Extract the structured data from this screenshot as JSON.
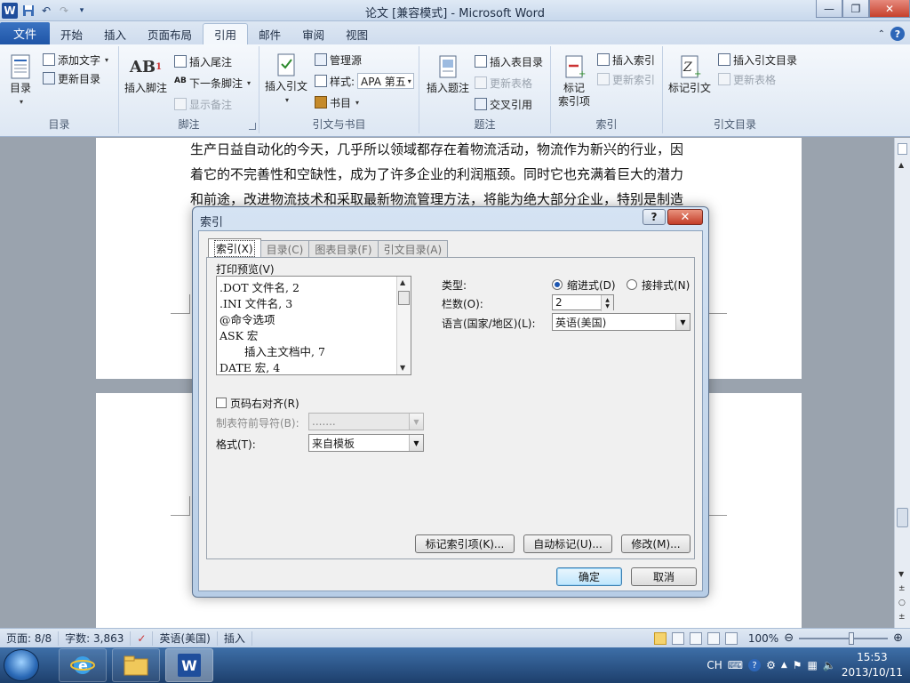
{
  "window": {
    "title": "论文 [兼容模式] - Microsoft Word"
  },
  "ribbon_tabs": {
    "file": "文件",
    "items": [
      "开始",
      "插入",
      "页面布局",
      "引用",
      "邮件",
      "审阅",
      "视图"
    ],
    "active": "引用"
  },
  "ribbon": {
    "toc": {
      "big": "目录",
      "add_text": "添加文字",
      "update_toc": "更新目录",
      "label": "目录"
    },
    "footnote": {
      "insert_footnote": "插入脚注",
      "insert_endnote": "插入尾注",
      "next_footnote": "下一条脚注",
      "show_notes": "显示备注",
      "label": "脚注"
    },
    "citation": {
      "insert_citation": "插入引文",
      "manage_sources": "管理源",
      "style_label": "样式:",
      "style_value": "APA 第五",
      "bibliography": "书目",
      "label": "引文与书目"
    },
    "caption": {
      "insert_caption": "插入题注",
      "insert_table_of_figures": "插入表目录",
      "update_table": "更新表格",
      "cross_reference": "交叉引用",
      "label": "题注"
    },
    "index": {
      "mark_entry": "标记\n索引项",
      "mark_entry_l1": "标记",
      "mark_entry_l2": "索引项",
      "insert_index": "插入索引",
      "update_index": "更新索引",
      "label": "索引"
    },
    "toa": {
      "mark_citation": "标记引文",
      "insert_toa": "插入引文目录",
      "update_table": "更新表格",
      "label": "引文目录"
    }
  },
  "document": {
    "lines": [
      "生产日益自动化的今天，几乎所以领域都存在着物流活动，物流作为新兴的行业，因",
      "着它的不完善性和空缺性，成为了许多企业的利润瓶颈。同时它也充满着巨大的潜力",
      "和前途，改进物流技术和采取最新物流管理方法，将能为绝大部分企业，特别是制造"
    ]
  },
  "dialog": {
    "title": "索引",
    "help": "?",
    "close": "✕",
    "tabs": [
      "索引(X)",
      "目录(C)",
      "图表目录(F)",
      "引文目录(A)"
    ],
    "preview_label": "打印预览(V)",
    "preview_lines": [
      ".DOT 文件名, 2",
      ".INI 文件名, 3",
      "@命令选项",
      "ASK 宏",
      "插入主文档中, 7",
      "DATE 宏, 4"
    ],
    "type_label": "类型:",
    "type_indent": "缩进式(D)",
    "type_runin": "接排式(N)",
    "columns_label": "栏数(O):",
    "columns_value": "2",
    "language_label": "语言(国家/地区)(L):",
    "language_value": "英语(美国)",
    "right_align_label": "页码右对齐(R)",
    "tab_leader_label": "制表符前导符(B):",
    "tab_leader_value": ".......",
    "format_label": "格式(T):",
    "format_value": "来自模板",
    "mark_entry_btn": "标记索引项(K)...",
    "automark_btn": "自动标记(U)...",
    "modify_btn": "修改(M)...",
    "ok": "确定",
    "cancel": "取消"
  },
  "statusbar": {
    "page": "页面: 8/8",
    "words": "字数: 3,863",
    "language": "英语(美国)",
    "mode": "插入",
    "zoom": "100%"
  },
  "taskbar": {
    "ime": "CH",
    "time": "15:53",
    "date": "2013/10/11"
  },
  "colors": {
    "file_tab": "#1f55a7",
    "accent": "#2d66b8"
  }
}
